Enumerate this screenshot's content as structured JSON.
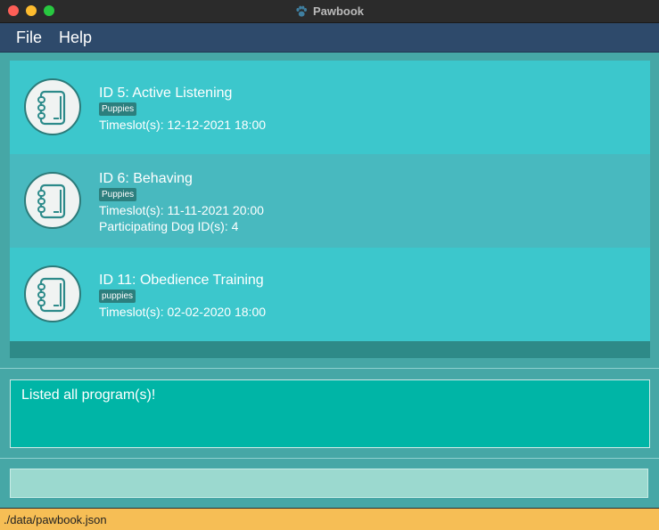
{
  "window": {
    "title": "Pawbook"
  },
  "menu": {
    "items": [
      "File",
      "Help"
    ]
  },
  "programs": [
    {
      "title": "ID 5:  Active Listening",
      "tag": "Puppies",
      "timeslot": "Timeslot(s): 12-12-2021 18:00",
      "dogs": ""
    },
    {
      "title": "ID 6:  Behaving",
      "tag": "Puppies",
      "timeslot": "Timeslot(s): 11-11-2021 20:00",
      "dogs": "Participating Dog ID(s): 4"
    },
    {
      "title": "ID 11:  Obedience Training",
      "tag": "puppies",
      "timeslot": "Timeslot(s): 02-02-2020 18:00",
      "dogs": ""
    }
  ],
  "result": {
    "text": "Listed all program(s)!"
  },
  "command": {
    "value": "",
    "placeholder": ""
  },
  "status": {
    "path": "./data/pawbook.json"
  },
  "colors": {
    "menubar": "#2e4a6b",
    "card": "#3cc7cc",
    "card_selected": "#48b9bf",
    "result_box": "#00b5a6",
    "status_bar": "#f6be55"
  },
  "icons": {
    "app": "paw-icon",
    "program": "notebook-icon"
  }
}
